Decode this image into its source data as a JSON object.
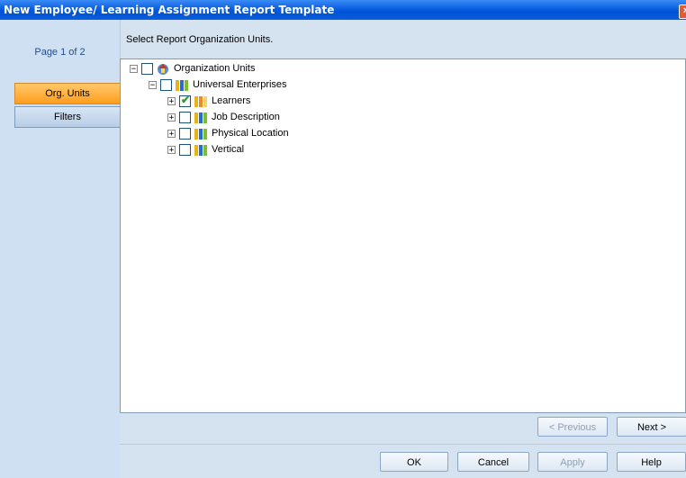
{
  "window": {
    "title": "New Employee/ Learning Assignment Report Template",
    "close_label": "×"
  },
  "sidebar": {
    "page_info": "Page 1 of 2",
    "items": [
      {
        "label": "Org. Units",
        "active": true
      },
      {
        "label": "Filters",
        "active": false
      }
    ]
  },
  "main": {
    "instruction": "Select Report Organization Units.",
    "tree": {
      "root": {
        "label": "Organization Units",
        "expander": "−",
        "checked": false
      },
      "child": {
        "label": "Universal Enterprises",
        "expander": "−",
        "checked": false
      },
      "items": [
        {
          "label": "Learners",
          "expander": "+",
          "checked": true
        },
        {
          "label": "Job Description",
          "expander": "+",
          "checked": false
        },
        {
          "label": "Physical Location",
          "expander": "+",
          "checked": false
        },
        {
          "label": "Vertical",
          "expander": "+",
          "checked": false
        }
      ]
    }
  },
  "buttons": {
    "previous": "< Previous",
    "next": "Next >",
    "ok": "OK",
    "cancel": "Cancel",
    "apply": "Apply",
    "help": "Help"
  },
  "icons": {
    "org_units": "globe-home-icon",
    "group": "people-group-icon",
    "check": "✔"
  },
  "colors": {
    "title_bar": "#0a5fe0",
    "active_nav": "#ffb347",
    "accent_check": "#21a121"
  }
}
